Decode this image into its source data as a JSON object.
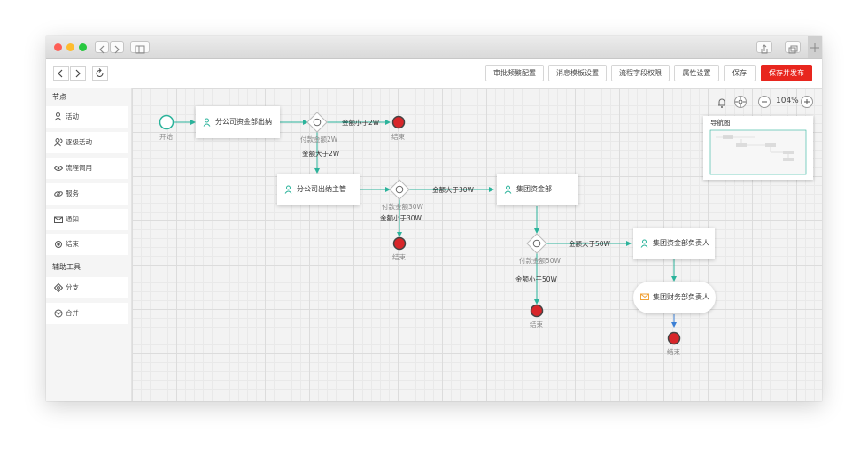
{
  "toolbar": {
    "buttons": [
      "审批频繁配置",
      "消息模板设置",
      "流程字段权限",
      "属性设置",
      "保存",
      "保存并发布"
    ]
  },
  "sidebar": {
    "section_nodes": "节点",
    "nodes": [
      "活动",
      "逐级活动",
      "流程调用",
      "服务",
      "通知",
      "结束"
    ],
    "section_tools": "辅助工具",
    "tools": [
      "分支",
      "合并"
    ]
  },
  "canvas": {
    "zoom": "104%",
    "minimap_title": "导航图"
  },
  "flow": {
    "start": "开始",
    "end": "结束",
    "tasks": [
      "分公司资金部出纳",
      "分公司出纳主管",
      "集团资金部",
      "集团资金部负责人",
      "集团财务部负责人"
    ],
    "gateway_labels": [
      "付款金额2W",
      "付款金额30W",
      "付款金额50W"
    ],
    "edges": [
      "金额小于2W",
      "金额大于2W",
      "金额大于30W",
      "金额小于30W",
      "金额大于50W",
      "金额小于50W"
    ]
  },
  "colors": {
    "accent": "#2bb39b",
    "primary_button": "#e8261e",
    "end_node": "#d8262a"
  },
  "icons": {
    "back": "chevron-left-icon",
    "forward": "chevron-right-icon",
    "refresh": "refresh-icon",
    "bell": "bell-icon",
    "locate": "locate-icon",
    "zoom_out": "minus-icon",
    "zoom_in": "plus-icon"
  }
}
